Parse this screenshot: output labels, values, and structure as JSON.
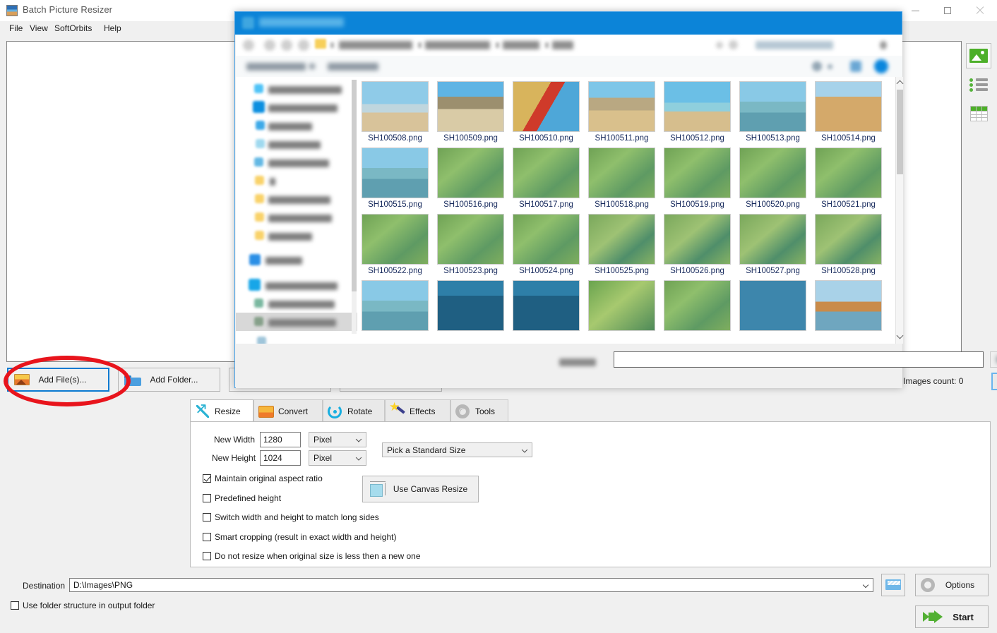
{
  "app": {
    "title": "Batch Picture Resizer",
    "title_icon": "picture-icon",
    "menu": [
      "File",
      "View",
      "SoftOrbits",
      "Help"
    ],
    "window_controls": {
      "minimize": "minimize-icon",
      "maximize": "maximize-icon",
      "close": "close-icon"
    }
  },
  "rail": {
    "thumbnails_view": "thumbnail-view-icon",
    "list_view": "list-view-icon",
    "details_view": "grid-view-icon"
  },
  "toolbar": {
    "add_files": "Add File(s)...",
    "add_folder": "Add Folder...",
    "images_count": "Images count: 0"
  },
  "tabs": [
    {
      "label": "Resize",
      "icon": "resize-arrow-icon",
      "active": true
    },
    {
      "label": "Convert",
      "icon": "convert-image-icon",
      "active": false
    },
    {
      "label": "Rotate",
      "icon": "rotate-icon",
      "active": false
    },
    {
      "label": "Effects",
      "icon": "magic-wand-icon",
      "active": false
    },
    {
      "label": "Tools",
      "icon": "gear-icon",
      "active": false
    }
  ],
  "resize": {
    "new_width_label": "New Width",
    "new_width_value": "1280",
    "new_width_unit": "Pixel",
    "new_height_label": "New Height",
    "new_height_value": "1024",
    "new_height_unit": "Pixel",
    "standard_size": "Pick a Standard Size",
    "canvas_button": "Use Canvas Resize",
    "canvas_icon": "canvas-resize-icon",
    "checkboxes": [
      {
        "label": "Maintain original aspect ratio",
        "checked": true
      },
      {
        "label": "Predefined height",
        "checked": false
      },
      {
        "label": "Switch width and height to match long sides",
        "checked": false
      },
      {
        "label": "Smart cropping (result in exact width and height)",
        "checked": false
      },
      {
        "label": "Do not resize when original size is less then a new one",
        "checked": false
      }
    ]
  },
  "bottom": {
    "destination_label": "Destination",
    "destination_value": "D:\\Images\\PNG",
    "browse_icon": "open-folder-icon",
    "folder_structure_label": "Use folder structure in output folder",
    "folder_structure_checked": false,
    "options_label": "Options",
    "options_icon": "gear-icon",
    "start_label": "Start",
    "start_icon": "green-arrow-icon"
  },
  "dialog": {
    "titlebar_color": "#0c84d8",
    "files": [
      "SH100508.png",
      "SH100509.png",
      "SH100510.png",
      "SH100511.png",
      "SH100512.png",
      "SH100513.png",
      "SH100514.png",
      "SH100515.png",
      "SH100516.png",
      "SH100517.png",
      "SH100518.png",
      "SH100519.png",
      "SH100520.png",
      "SH100521.png",
      "SH100522.png",
      "SH100523.png",
      "SH100524.png",
      "SH100525.png",
      "SH100526.png",
      "SH100527.png",
      "SH100528.png"
    ],
    "thumbnails": [
      {
        "name": "SH100508.png",
        "kind": "beach-sky"
      },
      {
        "name": "SH100509.png",
        "kind": "beach-people"
      },
      {
        "name": "SH100510.png",
        "kind": "beach-red"
      },
      {
        "name": "SH100511.png",
        "kind": "beach-umbrella"
      },
      {
        "name": "SH100512.png",
        "kind": "beach-sea"
      },
      {
        "name": "SH100513.png",
        "kind": "pier-sea"
      },
      {
        "name": "SH100514.png",
        "kind": "desert-dune"
      },
      {
        "name": "SH100515.png",
        "kind": "pier-sea"
      },
      {
        "name": "SH100516.png",
        "kind": "underwater-reef"
      },
      {
        "name": "SH100517.png",
        "kind": "underwater-reef"
      },
      {
        "name": "SH100518.png",
        "kind": "underwater-reef"
      },
      {
        "name": "SH100519.png",
        "kind": "underwater-reef"
      },
      {
        "name": "SH100520.png",
        "kind": "underwater-reef"
      },
      {
        "name": "SH100521.png",
        "kind": "underwater-reef"
      },
      {
        "name": "SH100522.png",
        "kind": "underwater-reef"
      },
      {
        "name": "SH100523.png",
        "kind": "underwater-reef"
      },
      {
        "name": "SH100524.png",
        "kind": "underwater-reef"
      },
      {
        "name": "SH100525.png",
        "kind": "underwater-fish"
      },
      {
        "name": "SH100526.png",
        "kind": "underwater-fish"
      },
      {
        "name": "SH100527.png",
        "kind": "underwater-fish"
      },
      {
        "name": "SH100528.png",
        "kind": "underwater-fish"
      },
      {
        "name": "",
        "kind": "pier-sea"
      },
      {
        "name": "",
        "kind": "divers"
      },
      {
        "name": "",
        "kind": "divers"
      },
      {
        "name": "",
        "kind": "coral"
      },
      {
        "name": "",
        "kind": "underwater-reef"
      },
      {
        "name": "",
        "kind": "swimmers"
      },
      {
        "name": "",
        "kind": "shore"
      }
    ]
  },
  "annotation": {
    "shape": "red-ellipse-highlight",
    "target": "add-files-button"
  }
}
